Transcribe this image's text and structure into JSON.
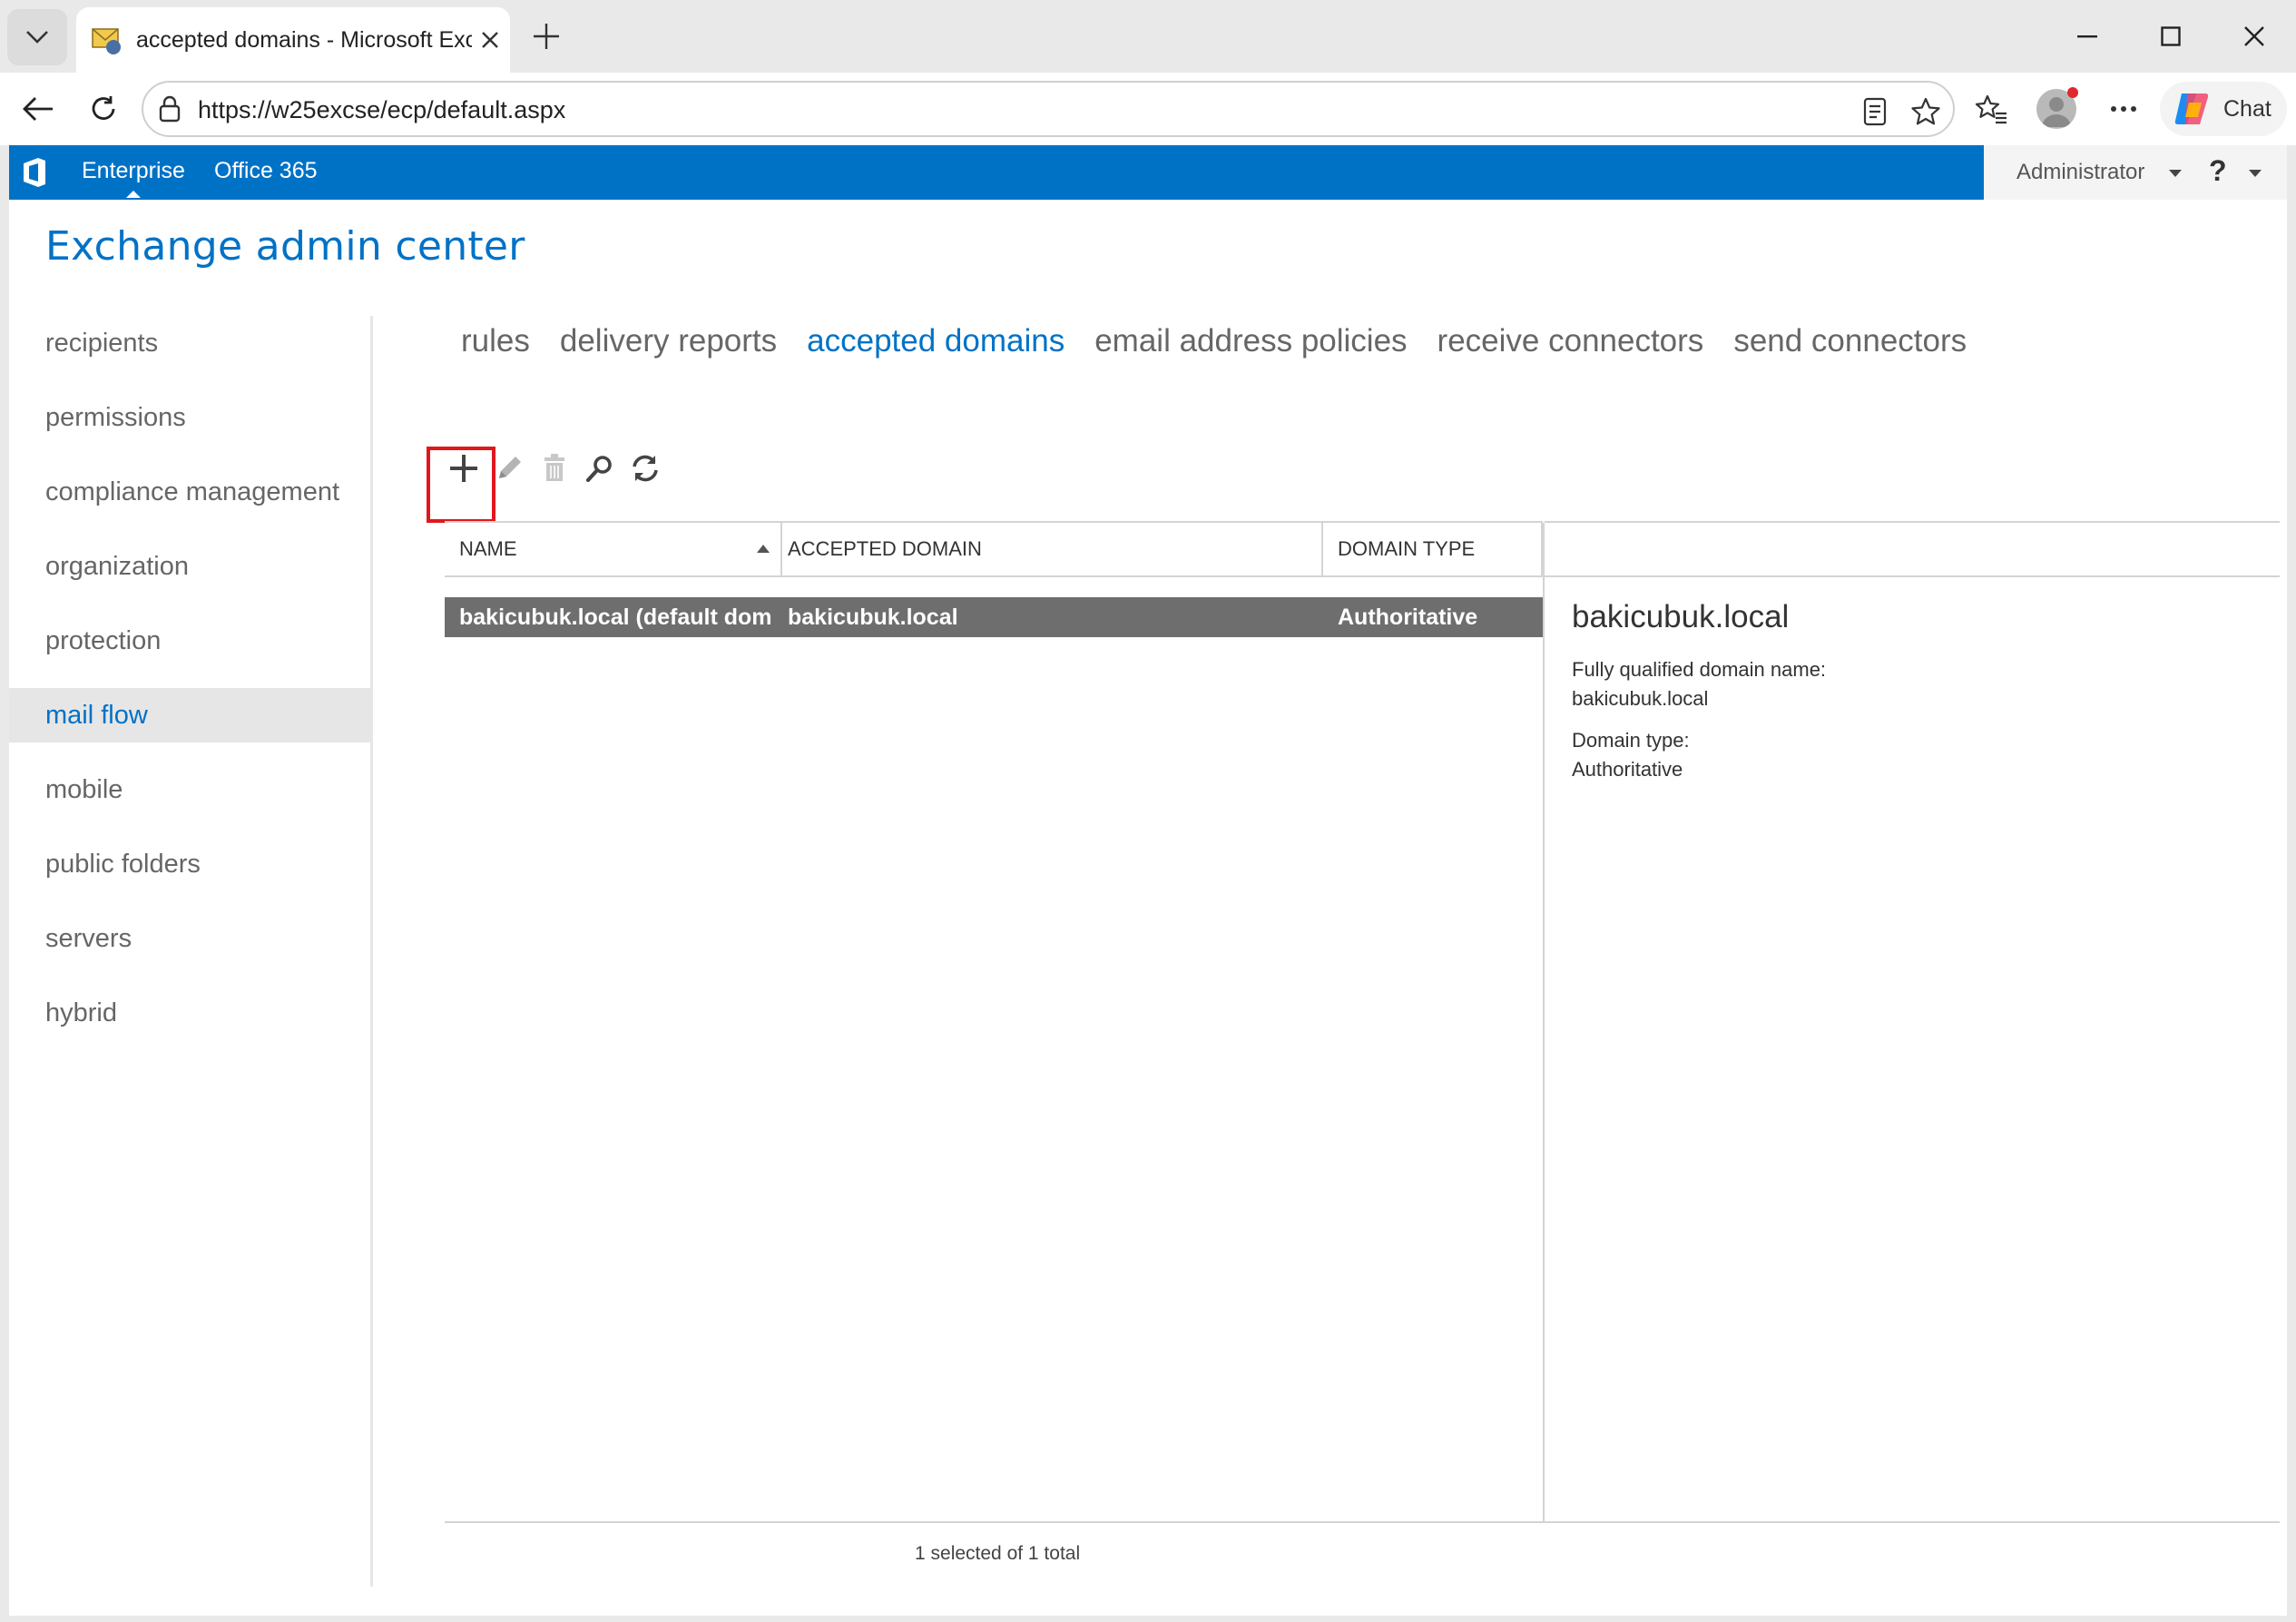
{
  "browser": {
    "tab_title": "accepted domains - Microsoft Exchange",
    "url": "https://w25excse/ecp/default.aspx",
    "chat_label": "Chat"
  },
  "o365": {
    "links": [
      "Enterprise",
      "Office 365"
    ],
    "user": "Administrator",
    "help": "?",
    "brand_color": "#0072c6"
  },
  "app": {
    "title": "Exchange admin center"
  },
  "leftnav": {
    "items": [
      {
        "label": "recipients"
      },
      {
        "label": "permissions"
      },
      {
        "label": "compliance management"
      },
      {
        "label": "organization"
      },
      {
        "label": "protection"
      },
      {
        "label": "mail flow"
      },
      {
        "label": "mobile"
      },
      {
        "label": "public folders"
      },
      {
        "label": "servers"
      },
      {
        "label": "hybrid"
      }
    ],
    "active": "mail flow"
  },
  "subnav": {
    "items": [
      {
        "label": "rules"
      },
      {
        "label": "delivery reports"
      },
      {
        "label": "accepted domains"
      },
      {
        "label": "email address policies"
      },
      {
        "label": "receive connectors"
      },
      {
        "label": "send connectors"
      }
    ],
    "active": "accepted domains"
  },
  "toolbar": {
    "icons": [
      "add-icon",
      "edit-icon",
      "delete-icon",
      "search-icon",
      "refresh-icon"
    ]
  },
  "grid": {
    "columns": [
      "NAME",
      "ACCEPTED DOMAIN",
      "DOMAIN TYPE"
    ],
    "rows": [
      {
        "name": "bakicubuk.local (default dom...",
        "domain": "bakicubuk.local",
        "type": "Authoritative"
      }
    ]
  },
  "details": {
    "title": "bakicubuk.local",
    "fqdn_label": "Fully qualified domain name:",
    "fqdn_value": "bakicubuk.local",
    "type_label": "Domain type:",
    "type_value": "Authoritative"
  },
  "status": "1 selected of 1 total"
}
